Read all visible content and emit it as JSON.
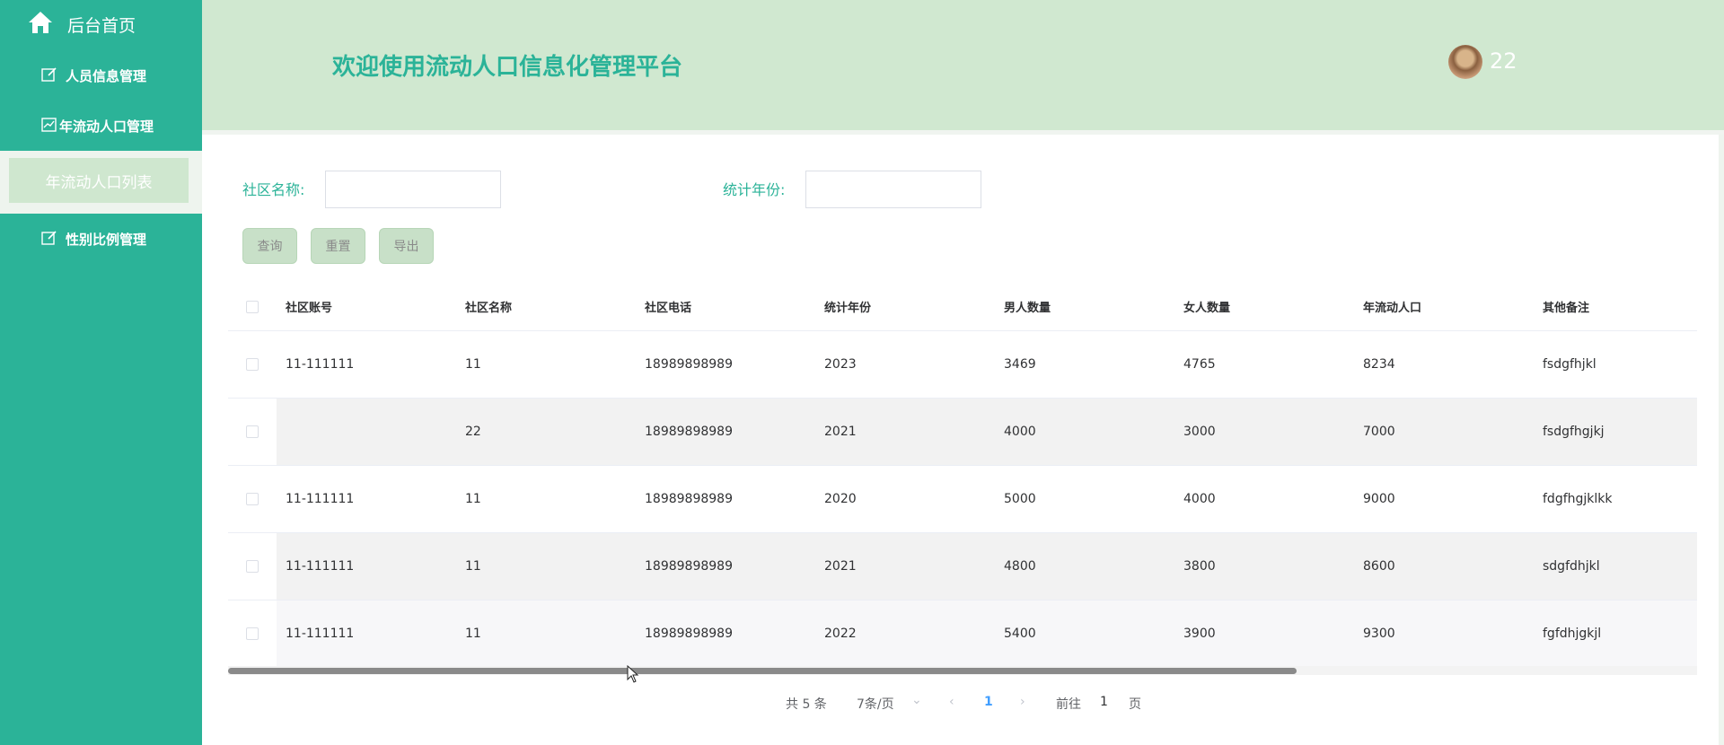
{
  "sidebar": {
    "home_label": "后台首页",
    "items": [
      {
        "label": "人员信息管理",
        "icon": "edit-icon"
      },
      {
        "label": "年流动人口管理",
        "icon": "chart-icon"
      },
      {
        "label": "性别比例管理",
        "icon": "edit-icon"
      }
    ],
    "submenu_active": "年流动人口列表",
    "color": "#2bb398"
  },
  "header": {
    "title": "欢迎使用流动人口信息化管理平台",
    "username": "22",
    "bg_color": "#d0e8d0"
  },
  "search": {
    "community_label": "社区名称:",
    "community_value": "",
    "year_label": "统计年份:",
    "year_value": ""
  },
  "buttons": {
    "query": "查询",
    "reset": "重置",
    "export": "导出"
  },
  "table": {
    "columns": [
      "社区账号",
      "社区名称",
      "社区电话",
      "统计年份",
      "男人数量",
      "女人数量",
      "年流动人口",
      "其他备注"
    ],
    "rows": [
      [
        "11-111111",
        "11",
        "18989898989",
        "2023",
        "3469",
        "4765",
        "8234",
        "fsdgfhjkl"
      ],
      [
        "",
        "22",
        "18989898989",
        "2021",
        "4000",
        "3000",
        "7000",
        "fsdgfhgjkj"
      ],
      [
        "11-111111",
        "11",
        "18989898989",
        "2020",
        "5000",
        "4000",
        "9000",
        "fdgfhgjklkk"
      ],
      [
        "11-111111",
        "11",
        "18989898989",
        "2021",
        "4800",
        "3800",
        "8600",
        "sdgfdhjkl"
      ],
      [
        "11-111111",
        "11",
        "18989898989",
        "2022",
        "5400",
        "3900",
        "9300",
        "fgfdhjgkjl"
      ]
    ]
  },
  "pagination": {
    "total": "共 5 条",
    "page_size": "7条/页",
    "current_page": "1",
    "goto_prefix": "前往",
    "goto_value": "1",
    "goto_suffix": "页"
  }
}
